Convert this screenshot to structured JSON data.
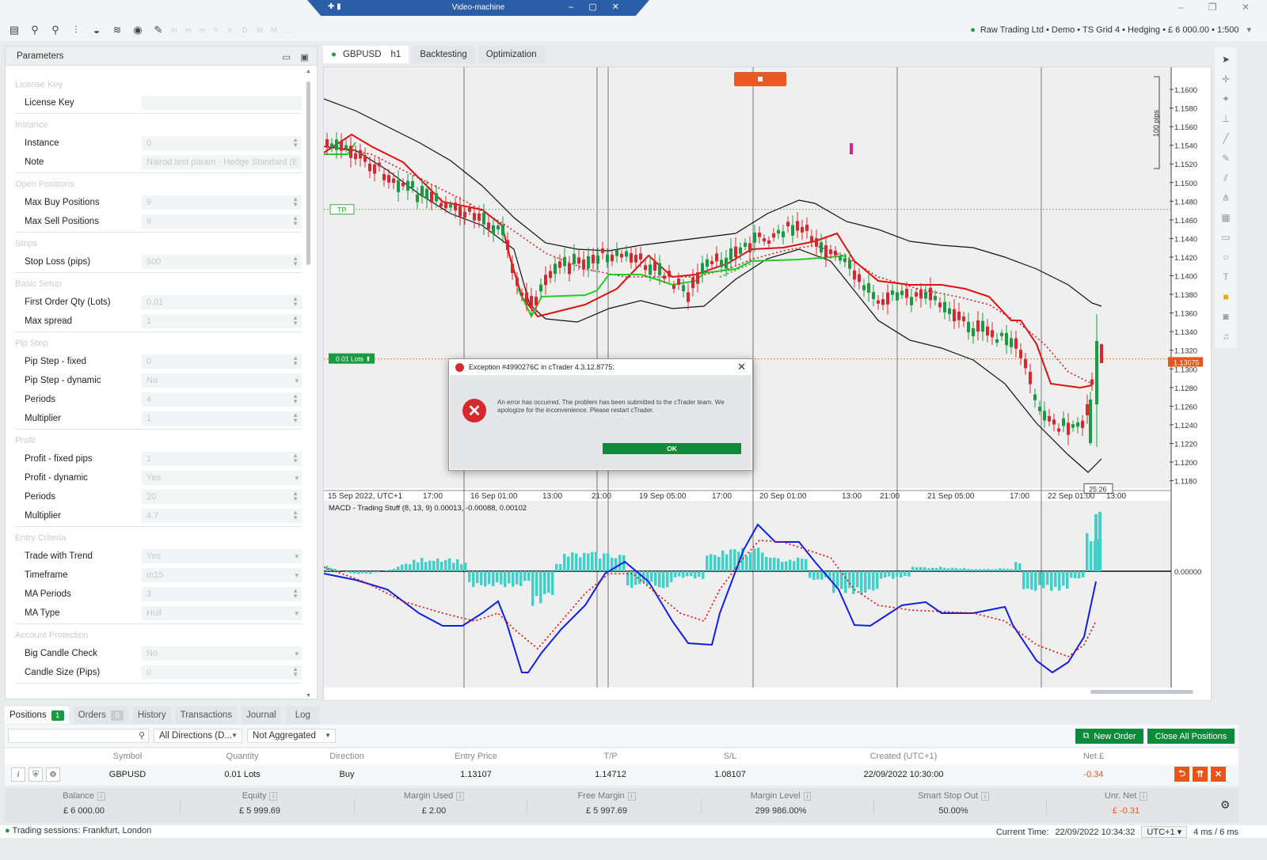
{
  "window": {
    "title": "Video-machine",
    "controls": [
      "–",
      "□",
      "✕"
    ],
    "outer_controls": [
      "–",
      "▢",
      "✕"
    ]
  },
  "account": {
    "text": "Raw Trading Ltd • Demo • TS Grid 4 • Hedging • £ 6 000.00 • 1:500"
  },
  "toolbar": {
    "icons": [
      "layout-icon",
      "zoom-in-icon",
      "zoom-out-icon",
      "indicators-icon",
      "cbots-icon",
      "layers-icon",
      "eye-icon",
      "edit-icon"
    ],
    "timeframes": [
      "m",
      "m",
      "m",
      "h",
      "h",
      "D",
      "W",
      "M",
      "..."
    ]
  },
  "params": {
    "title": "Parameters",
    "sections": [
      {
        "name": "License Key",
        "rows": [
          {
            "label": "License Key",
            "value": "",
            "type": "text"
          }
        ]
      },
      {
        "name": "Instance",
        "rows": [
          {
            "label": "Instance",
            "value": "0",
            "type": "num"
          },
          {
            "label": "Note",
            "value": "Nairod test param - Hedge Standard (E",
            "type": "text"
          }
        ]
      },
      {
        "name": "Open Positions",
        "rows": [
          {
            "label": "Max Buy Positions",
            "value": "9",
            "type": "num"
          },
          {
            "label": "Max Sell Positions",
            "value": "9",
            "type": "num"
          }
        ]
      },
      {
        "name": "Stops",
        "rows": [
          {
            "label": "Stop Loss (pips)",
            "value": "500",
            "type": "num"
          }
        ]
      },
      {
        "name": "Basic Setup",
        "rows": [
          {
            "label": "First Order Qty (Lots)",
            "value": "0.01",
            "type": "num"
          },
          {
            "label": "Max spread",
            "value": "1",
            "type": "num"
          }
        ]
      },
      {
        "name": "Pip Step",
        "rows": [
          {
            "label": "Pip Step - fixed",
            "value": "0",
            "type": "num"
          },
          {
            "label": "Pip Step - dynamic",
            "value": "No",
            "type": "sel"
          },
          {
            "label": "Periods",
            "value": "4",
            "type": "num"
          },
          {
            "label": "Multiplier",
            "value": "1",
            "type": "num"
          }
        ]
      },
      {
        "name": "Profit",
        "rows": [
          {
            "label": "Profit - fixed pips",
            "value": "1",
            "type": "num"
          },
          {
            "label": "Profit - dynamic",
            "value": "Yes",
            "type": "sel"
          },
          {
            "label": "Periods",
            "value": "20",
            "type": "num"
          },
          {
            "label": "Multiplier",
            "value": "4.7",
            "type": "num"
          }
        ]
      },
      {
        "name": "Entry Criteria",
        "rows": [
          {
            "label": "Trade with Trend",
            "value": "Yes",
            "type": "sel"
          },
          {
            "label": "Timeframe",
            "value": "m15",
            "type": "sel"
          },
          {
            "label": "MA Periods",
            "value": "3",
            "type": "num"
          },
          {
            "label": "MA Type",
            "value": "Hull",
            "type": "sel"
          }
        ]
      },
      {
        "name": "Account Protection",
        "rows": [
          {
            "label": "Big Candle Check",
            "value": "No",
            "type": "sel"
          },
          {
            "label": "Candle Size (Pips)",
            "value": "0",
            "type": "num"
          }
        ]
      }
    ]
  },
  "chart_tabs": [
    {
      "symbol": "GBPUSD",
      "timeframe": "h1",
      "active": true
    },
    {
      "label": "Backtesting"
    },
    {
      "label": "Optimization"
    }
  ],
  "chart": {
    "price_ticks": [
      "1.1600",
      "1.1580",
      "1.1560",
      "1.1540",
      "1.1520",
      "1.1500",
      "1.1480",
      "1.1460",
      "1.1440",
      "1.1420",
      "1.1400",
      "1.1380",
      "1.1360",
      "1.1340",
      "1.1320",
      "1.1300",
      "1.1280",
      "1.1260",
      "1.1240",
      "1.1220",
      "1.1200",
      "1.1180"
    ],
    "time_ticks": [
      "15 Sep 2022, UTC+1",
      "17:00",
      "16 Sep 01:00",
      "13:00",
      "21:00",
      "19 Sep 05:00",
      "17:00",
      "20 Sep 01:00",
      "13:00",
      "21:00",
      "21 Sep 05:00",
      "17:00",
      "22 Sep 01:00",
      "13:00"
    ],
    "current_price": "1.13075",
    "countdown": "25:26",
    "pips_label": "100 pips",
    "tp_label": "TP",
    "lots_label": "0.01 Lots",
    "macd_title": "MACD - Trading Stuff (8, 13, 9) 0.00013, -0.00088, 0.00102",
    "macd_zero": "0.00000",
    "colors": {
      "bull": "#1a9b42",
      "bear": "#d7282f",
      "channel": "#e00",
      "trail": "#22cc22",
      "macd_hist": "#40d0c8",
      "macd_line": "#1020e0",
      "signal": "#e00"
    }
  },
  "dialog": {
    "title": "Exception #4990276C in cTrader 4.3.12.8775:",
    "message": "An error has occurred. The problem has been submitted to the cTrader team. We apologize for the inconvenience. Please restart cTrader.",
    "ok": "OK"
  },
  "bottom": {
    "tabs": [
      {
        "label": "Positions",
        "count": "1",
        "active": true
      },
      {
        "label": "Orders",
        "count": "0"
      },
      {
        "label": "History"
      },
      {
        "label": "Transactions"
      },
      {
        "label": "Journal"
      },
      {
        "label": "Log"
      }
    ],
    "filter_direction": "All Directions (D...",
    "filter_aggregate": "Not Aggregated",
    "new_order": "New Order",
    "close_all": "Close All Positions",
    "columns": [
      "Symbol",
      "Quantity",
      "Direction",
      "Entry Price",
      "T/P",
      "S/L",
      "Created (UTC+1)",
      "Net £"
    ],
    "row": {
      "symbol": "GBPUSD",
      "quantity": "0.01 Lots",
      "direction": "Buy",
      "entry": "1.13107",
      "tp": "1.14712",
      "sl": "1.08107",
      "created": "22/09/2022 10:30:00",
      "net": "-0.34"
    },
    "summary": [
      {
        "k": "Balance",
        "v": "£ 6 000.00"
      },
      {
        "k": "Equity",
        "v": "£ 5 999.69"
      },
      {
        "k": "Margin Used",
        "v": "£ 2.00"
      },
      {
        "k": "Free Margin",
        "v": "£ 5 997.69"
      },
      {
        "k": "Margin Level",
        "v": "299 986.00%"
      },
      {
        "k": "Smart Stop Out",
        "v": "50.00%"
      },
      {
        "k": "Unr. Net",
        "v": "£ -0.31"
      }
    ]
  },
  "status": {
    "sessions": "Trading sessions: Frankfurt, London",
    "time_label": "Current Time:",
    "time": "22/09/2022 10:34:32",
    "tz": "UTC+1",
    "latency": "4 ms / 6 ms"
  }
}
